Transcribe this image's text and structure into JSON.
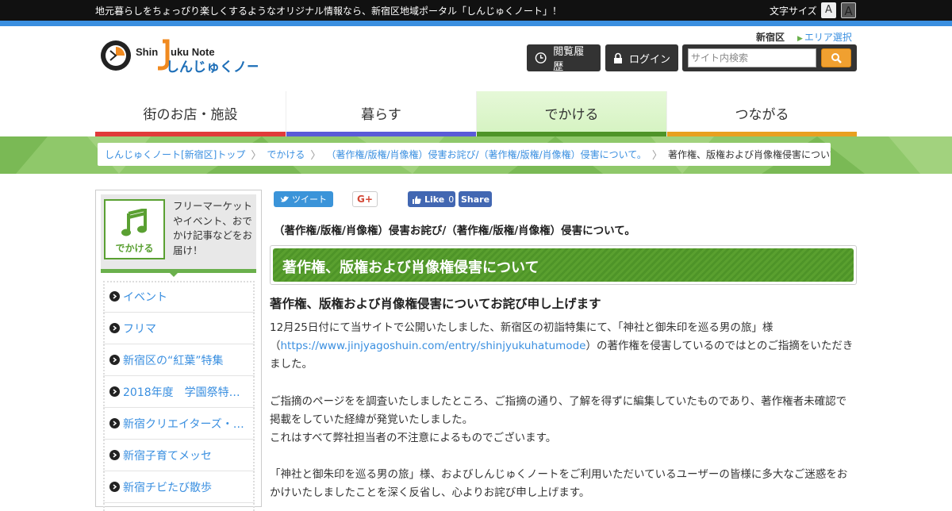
{
  "topbar": {
    "message": "地元暮らしをちょっぴり楽しくするようなオリジナル情報なら、新宿区地域ポータル「しんじゅくノート」！",
    "font_size_label": "文字サイズ",
    "font_small": "A",
    "font_large": "A"
  },
  "header": {
    "logo_alt": "Shinjuku Note しんじゅくノート",
    "area_name": "新宿区",
    "area_link": "エリア選択",
    "history_button": "閲覧履歴",
    "login_button": "ログイン",
    "search_placeholder": "サイト内検索"
  },
  "nav": {
    "items": [
      {
        "label": "街のお店・施設",
        "color": "#e03a3a"
      },
      {
        "label": "暮らす",
        "color": "#5a5ad8"
      },
      {
        "label": "でかける",
        "color": "#4e9428"
      },
      {
        "label": "つながる",
        "color": "#e8a020"
      }
    ]
  },
  "breadcrumb": [
    "しんじゅくノート[新宿区]トップ",
    "でかける",
    "（著作権/版権/肖像権）侵害お詫び/（著作権/版権/肖像権）侵害について。",
    "著作権、版権および肖像権侵害について"
  ],
  "sidebar": {
    "category_label": "でかける",
    "category_icon": "music-note-icon",
    "description": "フリーマーケットやイベント、おでかけ記事などをお届け！",
    "items": [
      "イベント",
      "フリマ",
      "新宿区の“紅葉”特集",
      "2018年度　学園祭特集…",
      "新宿クリエイターズ・…",
      "新宿子育てメッセ",
      "新宿チビたび散歩"
    ]
  },
  "social": {
    "tweet": "ツイート",
    "gplus": "G+",
    "fb_like": "Like",
    "fb_count": "0",
    "fb_share": "Share"
  },
  "article": {
    "category_title": "（著作権/版権/肖像権）侵害お詫び/（著作権/版権/肖像権）侵害について。",
    "title": "著作権、版権および肖像権侵害について",
    "heading": "著作権、版権および肖像権侵害についてお詫び申し上げます",
    "p1_before": "12月25日付にて当サイトで公開いたしました、新宿区の初詣特集にて、「神社と御朱印を巡る男の旅」様（",
    "p1_link": "https://www.jinjyagoshuin.com/entry/shinjyukuhatumode",
    "p1_after": "）の著作権を侵害しているのではとのご指摘をいただきました。",
    "p2": "ご指摘のページをを調査いたしましたところ、ご指摘の通り、了解を得ずに編集していたものであり、著作権者未確認で掲載をしていた経緯が発覚いたしました。",
    "p3": "これはすべて弊社担当者の不注意によるものでございます。",
    "p4": "「神社と御朱印を巡る男の旅」様、およびしんじゅくノートをご利用いただいているユーザーの皆様に多大なご迷惑をおかけいたしましたことを深く反省し、心よりお詫び申し上げます。"
  }
}
